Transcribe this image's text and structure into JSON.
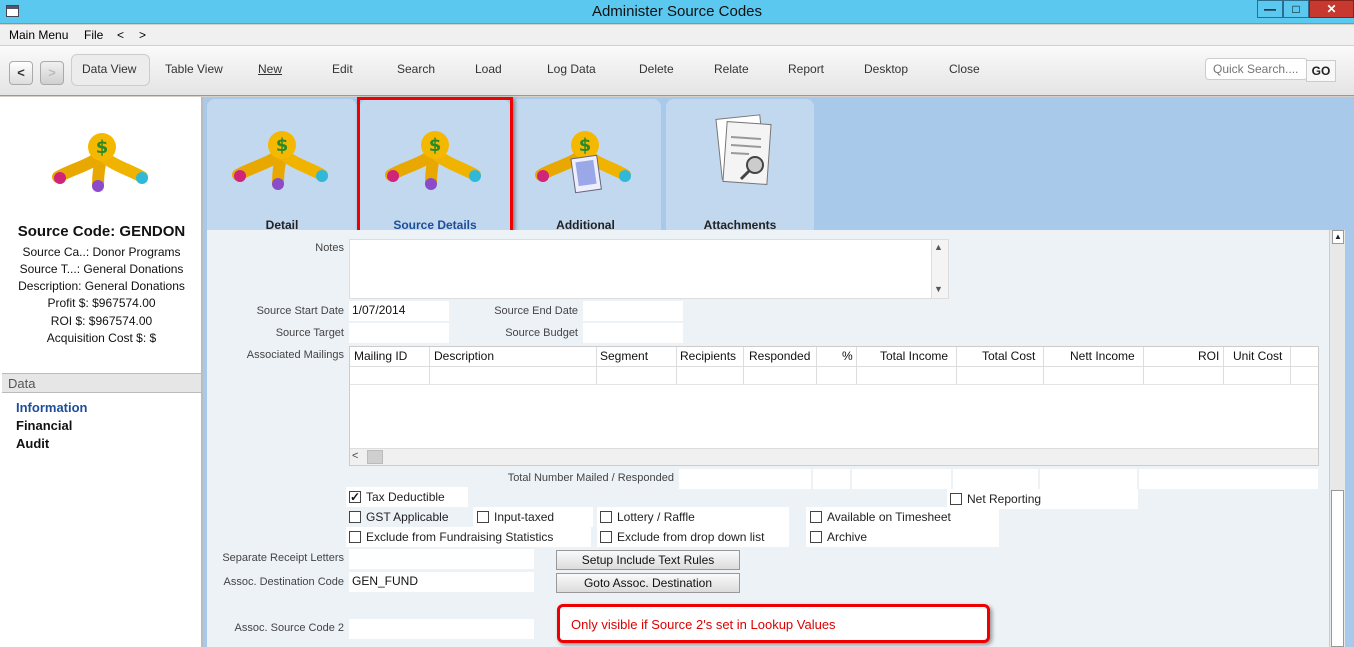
{
  "window": {
    "title": "Administer Source Codes",
    "min_glyph": "—",
    "max_glyph": "□",
    "close_glyph": "✕"
  },
  "menubar": {
    "items": [
      "Main Menu",
      "File",
      "<",
      ">"
    ]
  },
  "toolbar": {
    "back": "<",
    "forward": ">",
    "buttons": [
      "Data View",
      "Table View",
      "New",
      "Edit",
      "Search",
      "Load",
      "Log Data",
      "Delete",
      "Relate",
      "Report",
      "Desktop",
      "Close"
    ],
    "search_placeholder": "Quick Search....",
    "go": "GO"
  },
  "sidebar": {
    "title": "Source Code: GENDON",
    "lines": [
      "Source Ca..: Donor Programs",
      "Source T...: General Donations",
      "Description: General Donations",
      "Profit $: $967574.00",
      "ROI $: $967574.00",
      "Acquisition Cost $: $"
    ],
    "section": "Data",
    "items": [
      "Information",
      "Financial",
      "Audit"
    ]
  },
  "tabs": [
    "Detail",
    "Source Details",
    "Additional",
    "Attachments"
  ],
  "form": {
    "notes_label": "Notes",
    "source_start_date_label": "Source Start Date",
    "source_start_date": "1/07/2014",
    "source_end_date_label": "Source End Date",
    "source_end_date": "",
    "source_target_label": "Source Target",
    "source_target": "",
    "source_budget_label": "Source Budget",
    "source_budget": "",
    "associated_mailings_label": "Associated Mailings",
    "grid_columns": [
      "Mailing ID",
      "Description",
      "Segment",
      "Recipients",
      "Responded",
      "%",
      "Total Income",
      "Total Cost",
      "Nett Income",
      "ROI",
      "Unit Cost"
    ],
    "total_mailed_label": "Total Number Mailed / Responded",
    "checkboxes": {
      "tax_deductible": "Tax Deductible",
      "net_reporting": "Net Reporting",
      "gst_applicable": "GST Applicable",
      "input_taxed": "Input-taxed",
      "lottery_raffle": "Lottery / Raffle",
      "available_on_timesheet": "Available on Timesheet",
      "exclude_fundraising": "Exclude from Fundraising Statistics",
      "exclude_dropdown": "Exclude from drop down list",
      "archive": "Archive"
    },
    "separate_receipt_letters_label": "Separate Receipt Letters",
    "assoc_destination_code_label": "Assoc. Destination Code",
    "assoc_destination_code": "GEN_FUND",
    "assoc_source_code2_label": "Assoc. Source Code 2",
    "setup_include_text_rules": "Setup Include Text Rules",
    "goto_assoc_destination": "Goto Assoc. Destination"
  },
  "callout": "Only visible if Source 2's set in Lookup Values",
  "colors": {
    "titlebar": "#5ac8ef",
    "close": "#c7392e",
    "tabs_bg": "#a9c9ea",
    "highlight": "#e00000",
    "link": "#1e4d9a"
  }
}
